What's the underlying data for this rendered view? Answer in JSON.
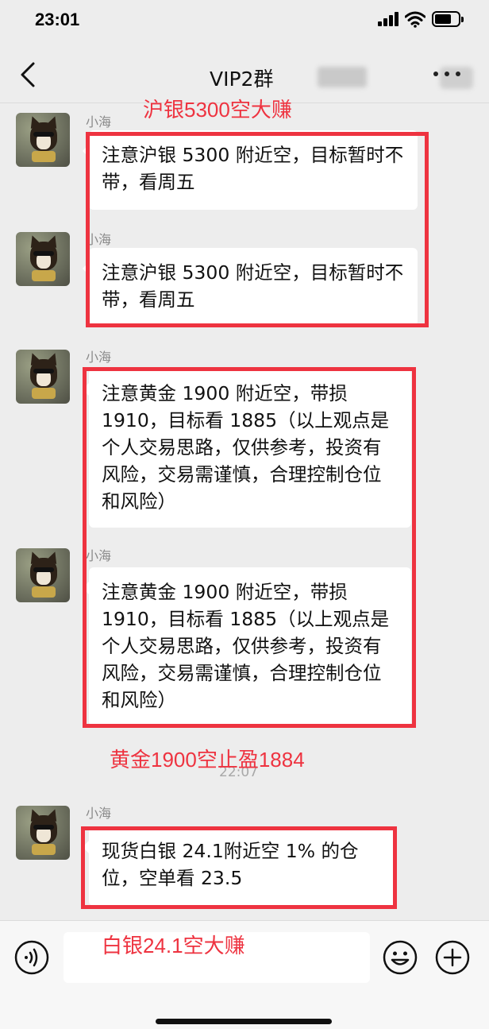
{
  "status_bar": {
    "time": "23:01"
  },
  "header": {
    "title": "VIP2群"
  },
  "messages": [
    {
      "sender": "小海",
      "text": "注意沪银 5300 附近空，目标暂时不带，看周五"
    },
    {
      "sender": "小海",
      "text": "注意沪银 5300 附近空，目标暂时不带，看周五"
    },
    {
      "sender": "小海",
      "text": "注意黄金 1900 附近空，带损 1910，目标看 1885（以上观点是个人交易思路，仅供参考，投资有风险，交易需谨慎，合理控制仓位和风险）"
    },
    {
      "sender": "小海",
      "text": "注意黄金 1900 附近空，带损 1910，目标看 1885（以上观点是个人交易思路，仅供参考，投资有风险，交易需谨慎，合理控制仓位和风险）"
    },
    {
      "sender": "小海",
      "text": "现货白银 24.1附近空 1% 的仓位，空单看 23.5"
    }
  ],
  "timestamp": "22:07",
  "annotations": {
    "silver_note": "沪银5300空大赚",
    "gold_note": "黄金1900空止盈1884",
    "spot_silver_note": "白银24.1空大赚",
    "color": "#ee3340"
  },
  "input_bar": {
    "voice_icon": "voice-icon",
    "emoji_icon": "emoji-icon",
    "plus_icon": "plus-icon"
  }
}
